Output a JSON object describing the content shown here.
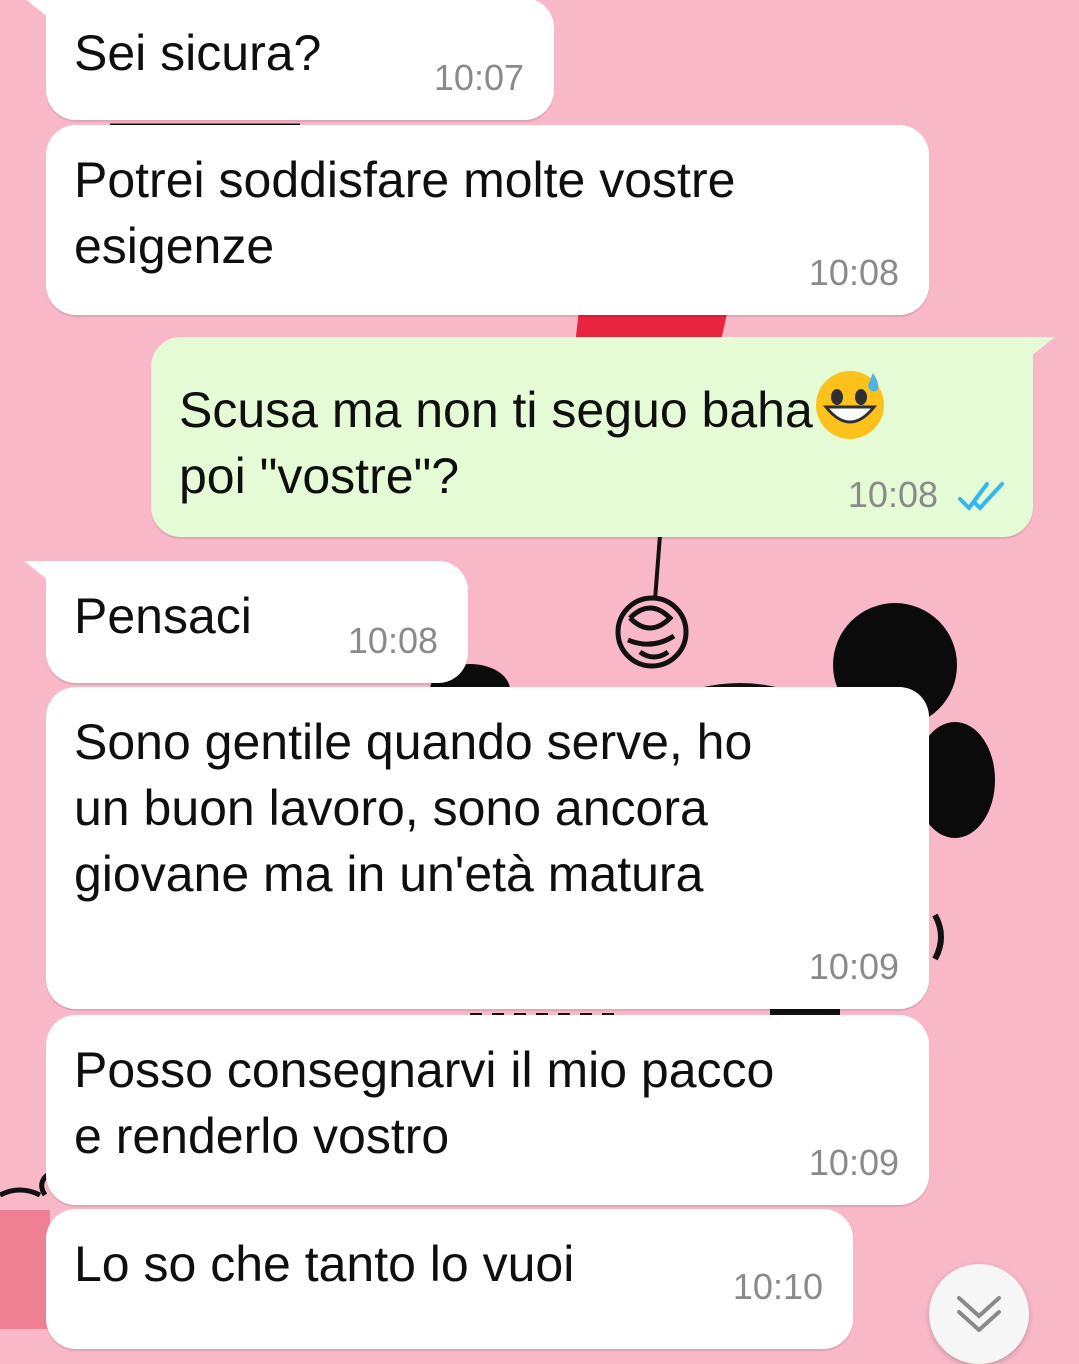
{
  "chat": {
    "messages": [
      {
        "direction": "incoming",
        "text": "Sei sicura?",
        "time": "10:07"
      },
      {
        "direction": "incoming",
        "text": "Potrei soddisfare molte vostre\nesigenze",
        "time": "10:08"
      },
      {
        "direction": "outgoing",
        "text_line1": "Scusa ma non ti seguo baha",
        "emoji": "grinning-face-with-sweat-emoji",
        "text_line2": "poi \"vostre\"?",
        "time": "10:08",
        "status": "read"
      },
      {
        "direction": "incoming",
        "text": "Pensaci",
        "time": "10:08"
      },
      {
        "direction": "incoming",
        "text": "Sono gentile quando serve, ho\nun buon lavoro, sono ancora\ngiovane ma in un'età matura",
        "time": "10:09"
      },
      {
        "direction": "incoming",
        "text": "Posso consegnarvi il mio pacco\ne renderlo vostro",
        "time": "10:09"
      },
      {
        "direction": "incoming",
        "text": "Lo so che tanto lo vuoi",
        "time": "10:10"
      }
    ]
  },
  "scroll_button": {
    "icon": "double-chevron-down-icon"
  },
  "colors": {
    "wallpaper": "#f8b8c8",
    "incoming_bubble": "#ffffff",
    "outgoing_bubble": "#e4fbd6",
    "read_ticks": "#34b7f1",
    "timestamp": "#8a8a8a"
  }
}
